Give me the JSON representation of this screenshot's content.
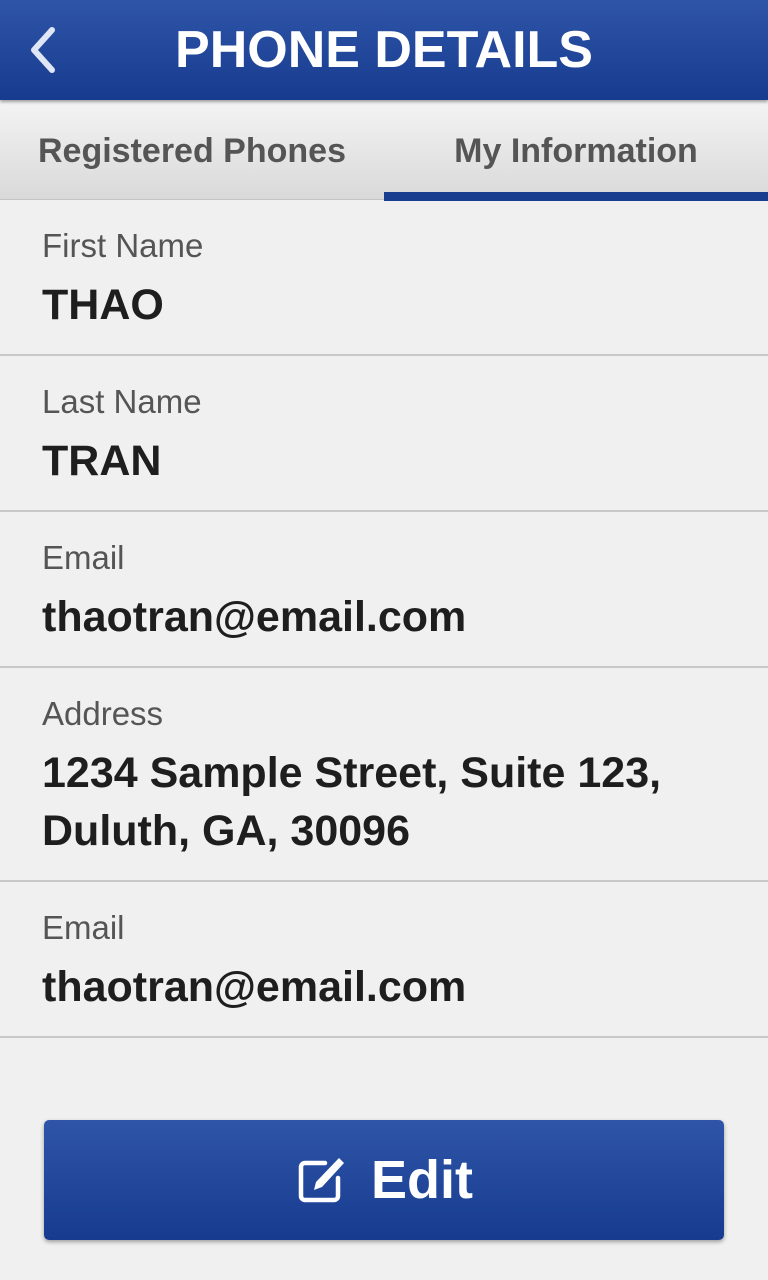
{
  "header": {
    "title": "PHONE DETAILS",
    "back_icon": "chevron-left-icon"
  },
  "tabs": [
    {
      "label": "Registered Phones",
      "active": false
    },
    {
      "label": "My Information",
      "active": true
    }
  ],
  "fields": [
    {
      "label": "First Name",
      "value": "THAO"
    },
    {
      "label": "Last Name",
      "value": "TRAN"
    },
    {
      "label": "Email",
      "value": "thaotran@email.com"
    },
    {
      "label": "Address",
      "value": "1234 Sample Street, Suite 123, Duluth, GA, 30096"
    },
    {
      "label": "Email",
      "value": "thaotran@email.com"
    }
  ],
  "edit_button": {
    "label": "Edit",
    "icon": "edit-pencil-icon"
  },
  "colors": {
    "brand_blue": "#1a3e8f",
    "background": "#f0f0f0",
    "text_dark": "#1e1e1e",
    "text_label": "#555555"
  }
}
